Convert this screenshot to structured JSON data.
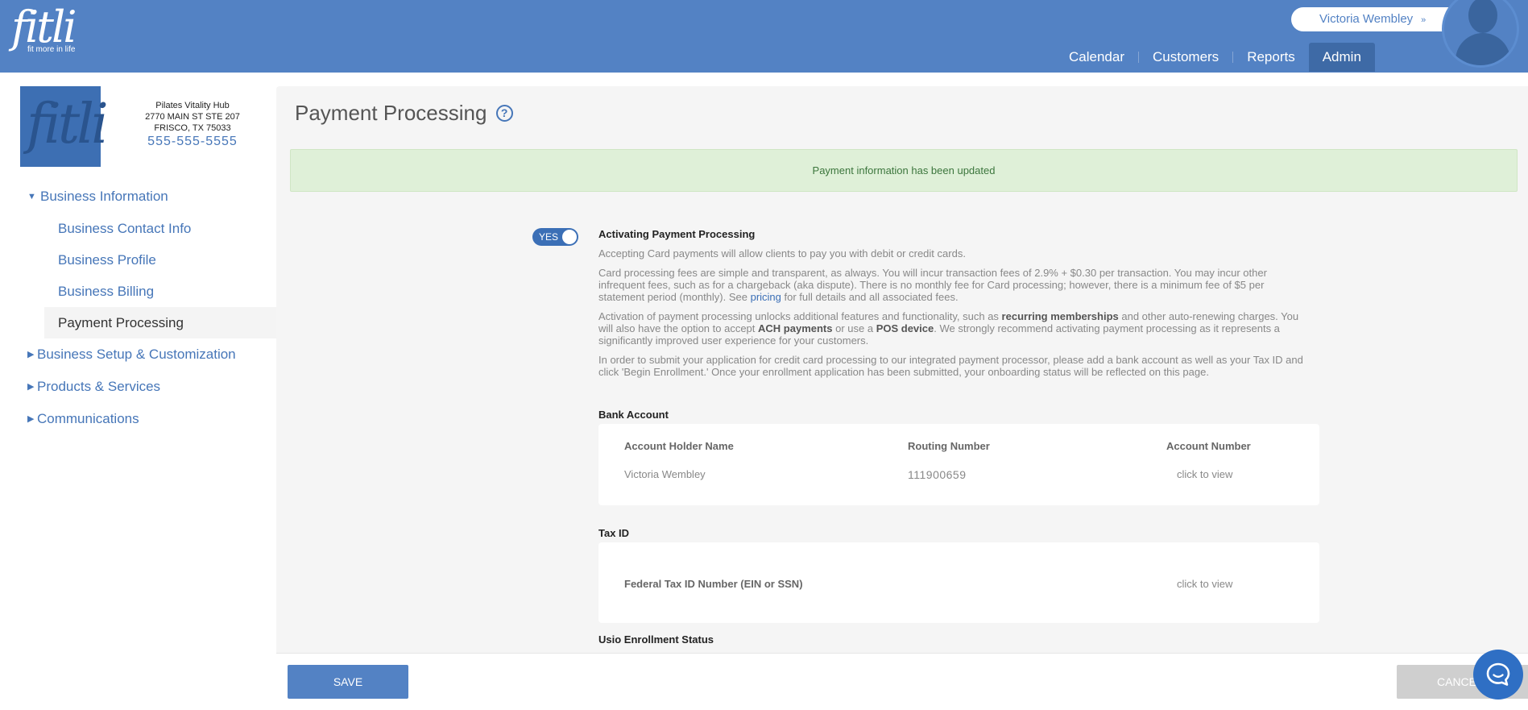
{
  "header": {
    "logo_word": "fitli",
    "logo_tagline": "fit more in life",
    "user_name": "Victoria Wembley",
    "user_chevron": "»",
    "nav": [
      "Calendar",
      "Customers",
      "Reports",
      "Admin"
    ],
    "active_nav": "Admin",
    "brand_color": "#5382c4"
  },
  "business": {
    "logo_word": "fitli",
    "name": "Pilates Vitality Hub",
    "address1": "2770 MAIN ST STE 207",
    "address2": "FRISCO, TX 75033",
    "phone": "555-555-5555"
  },
  "sidebar": {
    "sections": [
      {
        "label": "Business Information",
        "expanded": true
      },
      {
        "label": "Business Setup & Customization",
        "expanded": false
      },
      {
        "label": "Products & Services",
        "expanded": false
      },
      {
        "label": "Communications",
        "expanded": false
      }
    ],
    "sub_items": [
      "Business Contact Info",
      "Business Profile",
      "Business Billing",
      "Payment Processing"
    ],
    "active_item": "Payment Processing"
  },
  "main": {
    "title": "Payment Processing",
    "help_glyph": "?",
    "alert": "Payment information has been updated",
    "toggle_label": "YES",
    "toggle_on": true,
    "heading": "Activating Payment Processing",
    "p1": "Accepting Card payments will allow clients to pay you with debit or credit cards.",
    "p2_a": "Card processing fees are simple and transparent, as always. You will incur transaction fees of 2.9% + $0.30 per transaction. You may incur other infrequent fees, such as for a chargeback (aka dispute). There is no monthly fee for Card processing; however, there is a minimum fee of $5 per statement period (monthly). See ",
    "p2_link": "pricing",
    "p2_b": " for full details and all associated fees.",
    "p3_a": "Activation of payment processing unlocks additional features and functionality, such as ",
    "p3_b1": "recurring memberships",
    "p3_c": " and other auto-renewing charges. You will also have the option to accept ",
    "p3_b2": "ACH payments",
    "p3_d": " or use a ",
    "p3_b3": "POS device",
    "p3_e": ". We strongly recommend activating payment processing as it represents a significantly improved user experience for your customers.",
    "p4": "In order to submit your application for credit card processing to our integrated payment processor, please add a bank account as well as your Tax ID and click 'Begin Enrollment.' Once your enrollment application has been submitted, your onboarding status will be reflected on this page.",
    "bank_label": "Bank Account",
    "bank": {
      "holder_header": "Account Holder Name",
      "routing_header": "Routing Number",
      "account_header": "Account Number",
      "holder_value": "Victoria Wembley",
      "routing_value": "111900659",
      "account_value": "click to view"
    },
    "tax_label": "Tax ID",
    "tax": {
      "header": "Federal Tax ID Number (EIN or SSN)",
      "value": "click to view"
    },
    "enrollment_label": "Usio Enrollment Status"
  },
  "footer": {
    "save": "SAVE",
    "cancel": "CANCEL"
  }
}
